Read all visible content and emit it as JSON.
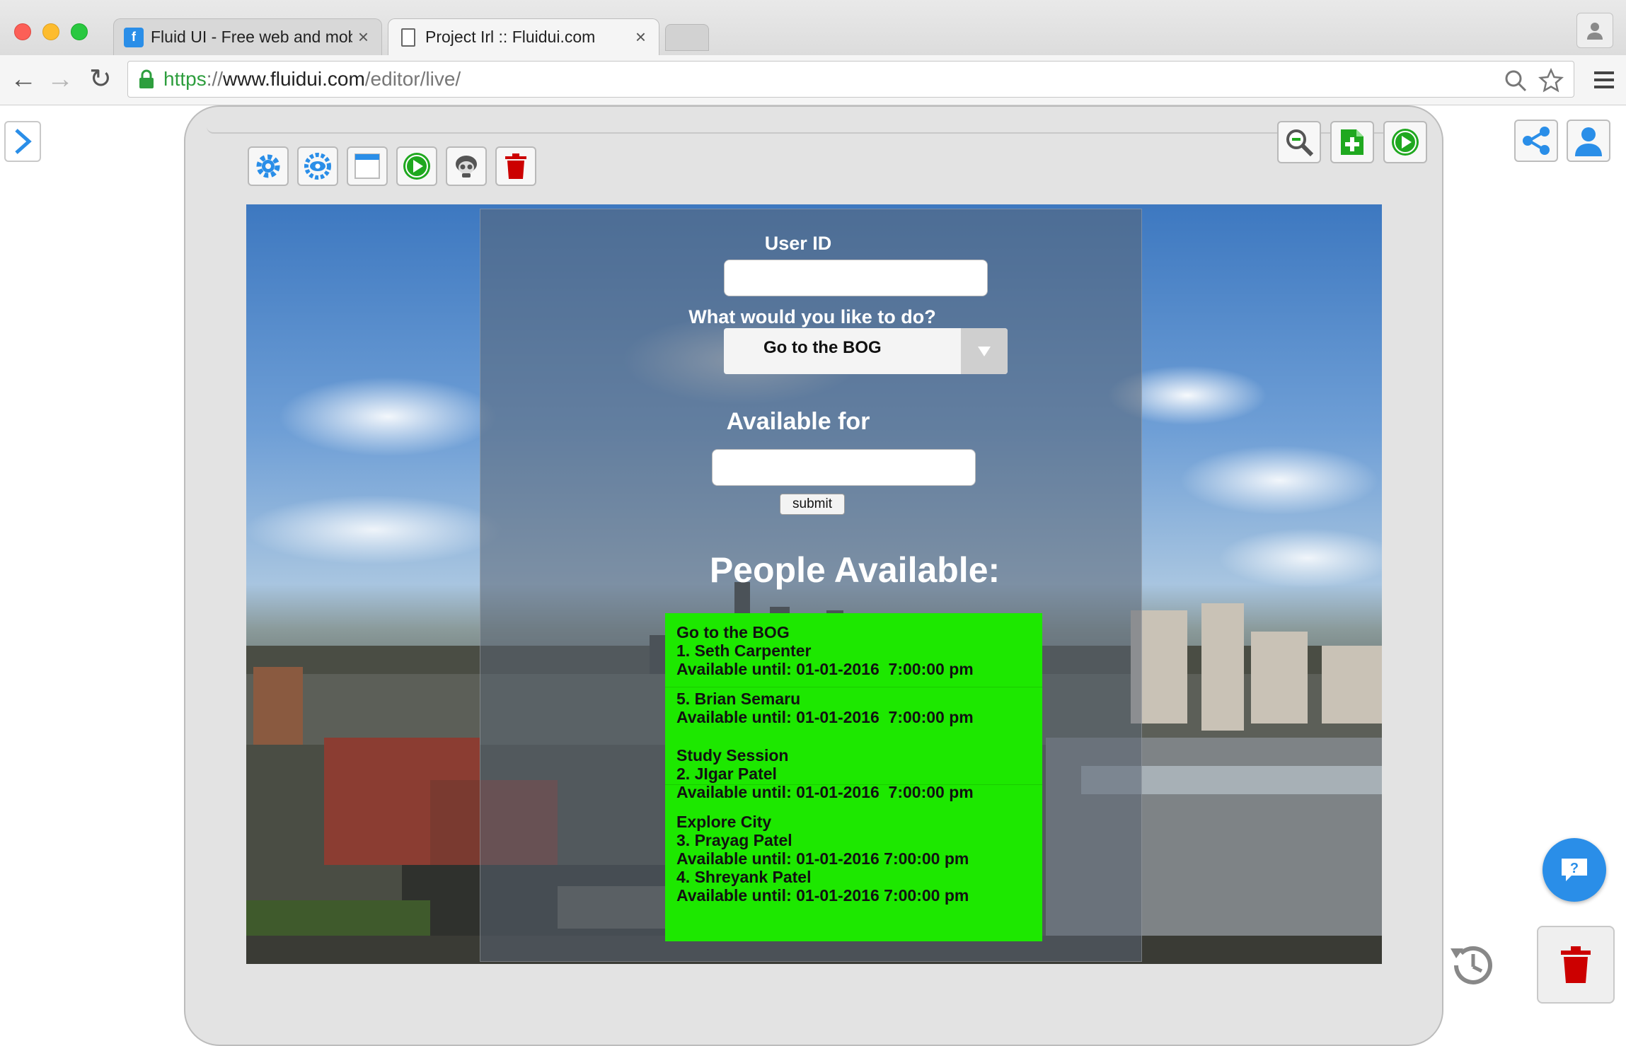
{
  "browser": {
    "tabs": [
      {
        "title": "Fluid UI - Free web and mobile",
        "active": false,
        "favicon": "fluidui-logo"
      },
      {
        "title": "Project Irl :: Fluidui.com",
        "active": true,
        "favicon": "page-icon"
      }
    ],
    "close_glyph": "×",
    "url_scheme": "https",
    "url_sep": "://",
    "url_host": "www.fluidui.com",
    "url_path": "/editor/live/"
  },
  "editor": {
    "toolbar_icons": [
      "settings-gear-icon",
      "preview-eye-icon",
      "page-layout-icon",
      "play-icon",
      "mask-icon",
      "delete-icon"
    ],
    "top_right_icons": [
      "zoom-out-icon",
      "add-page-icon",
      "play-icon"
    ],
    "side_icons": [
      "share-icon",
      "user-icon"
    ],
    "colors": {
      "accent": "#2a8ee8",
      "play_green": "#1fa81f",
      "add_green": "#1fa81f",
      "trash_red": "#cc0000",
      "list_green": "#1de800"
    }
  },
  "form": {
    "user_id_label": "User ID",
    "user_id_value": "",
    "todo_label": "What would you like to do?",
    "todo_selected": "Go to the BOG",
    "available_label": "Available for",
    "available_value": "",
    "submit_label": "submit",
    "people_heading": "People Available:"
  },
  "people": {
    "lines": [
      "Go to the BOG",
      "1. Seth Carpenter",
      "Available until: 01-01-2016  7:00:00 pm",
      "5. Brian Semaru",
      "Available until: 01-01-2016  7:00:00 pm",
      "Study Session",
      "2. JIgar Patel",
      "Available until: 01-01-2016  7:00:00 pm",
      "Explore City",
      "3. Prayag Patel",
      "Available until: 01-01-2016 7:00:00 pm",
      "4. Shreyank Patel",
      "Available until: 01-01-2016 7:00:00 pm"
    ]
  },
  "help_glyph": "?"
}
